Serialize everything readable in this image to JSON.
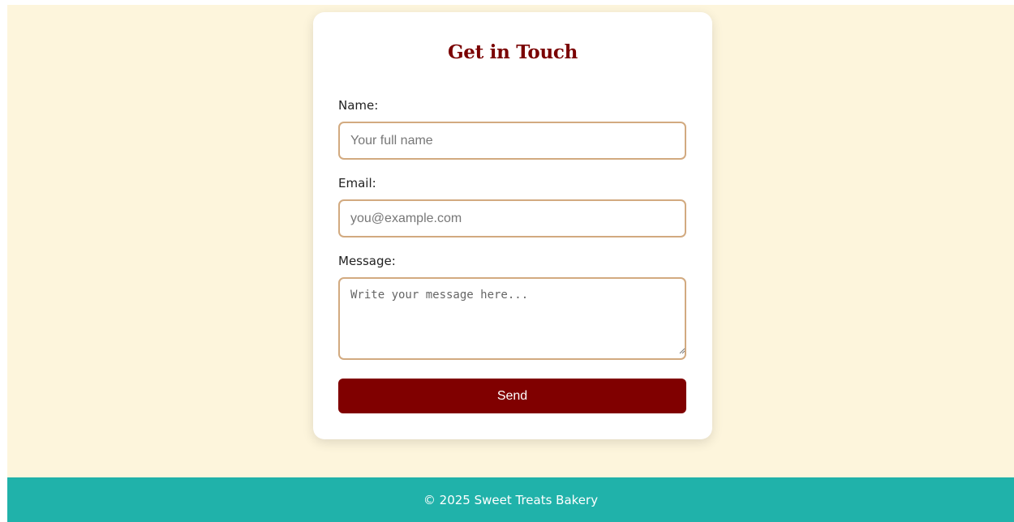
{
  "contact_form": {
    "title": "Get in Touch",
    "name_label": "Name:",
    "name_placeholder": "Your full name",
    "email_label": "Email:",
    "email_placeholder": "you@example.com",
    "message_label": "Message:",
    "message_placeholder": "Write your message here...",
    "send_label": "Send"
  },
  "footer": {
    "text": "© 2025 Sweet Treats Bakery"
  },
  "colors": {
    "page_background": "#fdf5dc",
    "title": "#7a0000",
    "field_border": "#d2aa80",
    "button": "#800000",
    "footer": "#20b2aa"
  }
}
